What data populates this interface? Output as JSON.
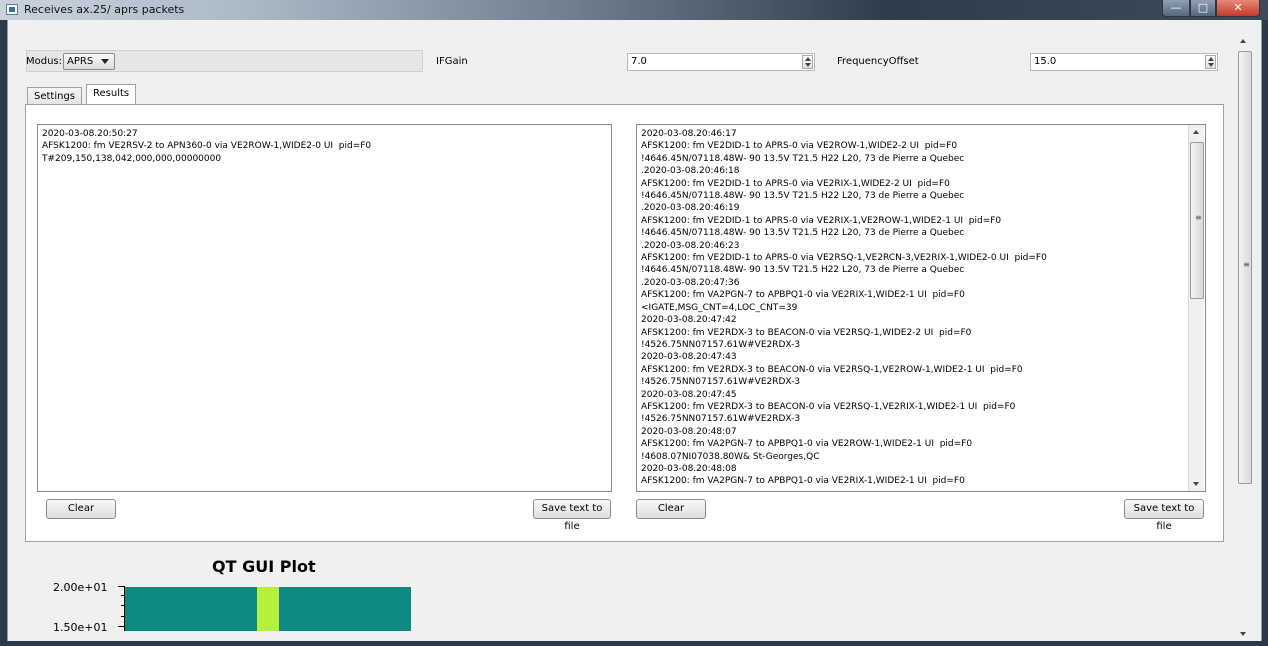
{
  "window": {
    "title": "Receives ax.25/ aprs packets",
    "minimize_glyph": "—",
    "maximize_glyph": "□",
    "close_glyph": "✕"
  },
  "controls": {
    "modus_label": "Modus:",
    "modus_value": "APRS",
    "ifgain_label": "IFGain",
    "ifgain_value": "7.0",
    "freqoffset_label": "FrequencyOffset",
    "freqoffset_value": "15.0"
  },
  "tabs": [
    {
      "label": "Settings",
      "active": false
    },
    {
      "label": "Results",
      "active": true
    }
  ],
  "left_panel": {
    "text": "2020-03-08.20:50:27\nAFSK1200: fm VE2RSV-2 to APN360-0 via VE2ROW-1,WIDE2-0 UI  pid=F0\nT#209,150,138,042,000,000,00000000",
    "clear_label": "Clear",
    "save_label": "Save text to file"
  },
  "right_panel": {
    "text": "2020-03-08.20:46:17\nAFSK1200: fm VE2DID-1 to APRS-0 via VE2ROW-1,WIDE2-2 UI  pid=F0\n!4646.45N/07118.48W- 90 13.5V T21.5 H22 L20, 73 de Pierre a Quebec\n.2020-03-08.20:46:18\nAFSK1200: fm VE2DID-1 to APRS-0 via VE2RIX-1,WIDE2-2 UI  pid=F0\n!4646.45N/07118.48W- 90 13.5V T21.5 H22 L20, 73 de Pierre a Quebec\n.2020-03-08.20:46:19\nAFSK1200: fm VE2DID-1 to APRS-0 via VE2RIX-1,VE2ROW-1,WIDE2-1 UI  pid=F0\n!4646.45N/07118.48W- 90 13.5V T21.5 H22 L20, 73 de Pierre a Quebec\n.2020-03-08.20:46:23\nAFSK1200: fm VE2DID-1 to APRS-0 via VE2RSQ-1,VE2RCN-3,VE2RIX-1,WIDE2-0 UI  pid=F0\n!4646.45N/07118.48W- 90 13.5V T21.5 H22 L20, 73 de Pierre a Quebec\n.2020-03-08.20:47:36\nAFSK1200: fm VA2PGN-7 to APBPQ1-0 via VE2RIX-1,WIDE2-1 UI  pid=F0\n<IGATE,MSG_CNT=4,LOC_CNT=39\n2020-03-08.20:47:42\nAFSK1200: fm VE2RDX-3 to BEACON-0 via VE2RSQ-1,WIDE2-2 UI  pid=F0\n!4526.75NN07157.61W#VE2RDX-3\n2020-03-08.20:47:43\nAFSK1200: fm VE2RDX-3 to BEACON-0 via VE2RSQ-1,VE2ROW-1,WIDE2-1 UI  pid=F0\n!4526.75NN07157.61W#VE2RDX-3\n2020-03-08.20:47:45\nAFSK1200: fm VE2RDX-3 to BEACON-0 via VE2RSQ-1,VE2RIX-1,WIDE2-1 UI  pid=F0\n!4526.75NN07157.61W#VE2RDX-3\n2020-03-08.20:48:07\nAFSK1200: fm VA2PGN-7 to APBPQ1-0 via VE2ROW-1,WIDE2-1 UI  pid=F0\n!4608.07NI07038.80W& St-Georges,QC\n2020-03-08.20:48:08\nAFSK1200: fm VA2PGN-7 to APBPQ1-0 via VE2RIX-1,WIDE2-1 UI  pid=F0",
    "clear_label": "Clear",
    "save_label": "Save text to file",
    "scroll_grip": "≡"
  },
  "page_scroll_grip": "≡",
  "plot": {
    "title": "QT GUI Plot",
    "y_ticks": [
      "2.00e+01",
      "1.50e+01"
    ],
    "background_color": "#0e8a82",
    "highlight_color": "#b6f03c"
  }
}
